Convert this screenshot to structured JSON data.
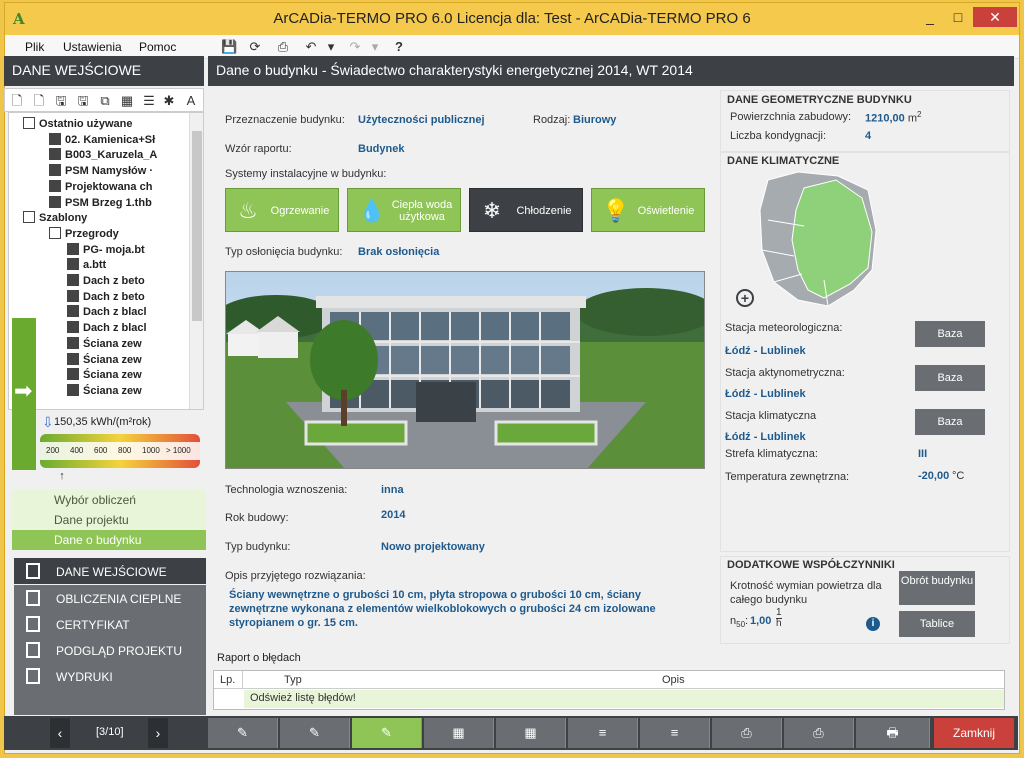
{
  "window": {
    "title": "ArCADia-TERMO PRO 6.0 Licencja dla: Test - ArCADia-TERMO PRO 6",
    "logo_glyph": "A",
    "minimize": "_",
    "maximize": "□",
    "close": "✕"
  },
  "menu": [
    "Plik",
    "Ustawienia",
    "Pomoc"
  ],
  "left": {
    "header": "DANE WEJŚCIOWE",
    "tree": [
      {
        "label": "Ostatnio używane",
        "level": 1,
        "kind": "folder"
      },
      {
        "label": "02. Kamienica+Sł",
        "level": 2,
        "kind": "doc"
      },
      {
        "label": "B003_Karuzela_A",
        "level": 2,
        "kind": "doc"
      },
      {
        "label": "PSM Namysłów ·",
        "level": 2,
        "kind": "doc"
      },
      {
        "label": "Projektowana ch",
        "level": 2,
        "kind": "doc"
      },
      {
        "label": "PSM Brzeg 1.thb",
        "level": 2,
        "kind": "doc"
      },
      {
        "label": "Szablony",
        "level": 1,
        "kind": "folder"
      },
      {
        "label": "Przegrody",
        "level": 2,
        "kind": "folder"
      },
      {
        "label": "PG- moja.bt",
        "level": 3,
        "kind": "doc"
      },
      {
        "label": "a.btt",
        "level": 3,
        "kind": "doc"
      },
      {
        "label": "Dach z beto",
        "level": 3,
        "kind": "doc"
      },
      {
        "label": "Dach z beto",
        "level": 3,
        "kind": "doc"
      },
      {
        "label": "Dach z blacl",
        "level": 3,
        "kind": "doc"
      },
      {
        "label": "Dach z blacl",
        "level": 3,
        "kind": "doc"
      },
      {
        "label": "Ściana zew",
        "level": 3,
        "kind": "doc"
      },
      {
        "label": "Ściana zew",
        "level": 3,
        "kind": "doc"
      },
      {
        "label": "Ściana zew",
        "level": 3,
        "kind": "doc"
      },
      {
        "label": "Ściana zew",
        "level": 3,
        "kind": "doc"
      }
    ],
    "energy_value": "150,35 kWh/(m²rok)",
    "energy_ticks": [
      "200",
      "400",
      "600",
      "800",
      "1000",
      "> 1000"
    ],
    "energy_indicator": 0.12,
    "sub_nav": [
      "Wybór obliczeń",
      "Dane projektu",
      "Dane o budynku"
    ],
    "main_nav": [
      "DANE WEJŚCIOWE",
      "OBLICZENIA CIEPLNE",
      "CERTYFIKAT",
      "PODGLĄD PROJEKTU",
      "WYDRUKI"
    ]
  },
  "main": {
    "header": "Dane o budynku - Świadectwo charakterystyki energetycznej 2014, WT 2014",
    "przeznaczenie_label": "Przeznaczenie budynku:",
    "przeznaczenie_value": "Użyteczności publicznej",
    "rodzaj_label": "Rodzaj:",
    "rodzaj_value": "Biurowy",
    "wzor_label": "Wzór raportu:",
    "wzor_value": "Budynek",
    "systemy_label": "Systemy instalacyjne w budynku:",
    "systems": [
      {
        "label": "Ogrzewanie",
        "icon": "flame-icon",
        "glyph": "♨",
        "active": false
      },
      {
        "label": "Ciepła woda użytkowa",
        "icon": "water-drop-icon",
        "glyph": "💧",
        "active": false
      },
      {
        "label": "Chłodzenie",
        "icon": "snowflake-icon",
        "glyph": "❄",
        "active": true
      },
      {
        "label": "Oświetlenie",
        "icon": "bulb-icon",
        "glyph": "💡",
        "active": false
      }
    ],
    "oslona_label": "Typ osłonięcia budynku:",
    "oslona_value": "Brak osłonięcia",
    "technologia_label": "Technologia wznoszenia:",
    "technologia_value": "inna",
    "rok_label": "Rok budowy:",
    "rok_value": "2014",
    "typ_label": "Typ budynku:",
    "typ_value": "Nowo projektowany",
    "opis_label": "Opis przyjętego rozwiązania:",
    "opis_value": "Ściany wewnętrzne o grubości 10 cm, płyta stropowa o grubości 10 cm, ściany zewnętrzne wykonana z elementów wielkoblokowych o grubości 24 cm izolowane styropianem o gr. 15 cm."
  },
  "right": {
    "geo_title": "DANE GEOMETRYCZNE BUDYNKU",
    "pow_label": "Powierzchnia zabudowy:",
    "pow_value": "1210,00",
    "pow_unit": "m",
    "pow_exp": "2",
    "kond_label": "Liczba kondygnacji:",
    "kond_value": "4",
    "klim_title": "DANE KLIMATYCZNE",
    "meteo_label": "Stacja meteorologiczna:",
    "meteo_value": "Łódź - Lublinek",
    "akty_label": "Stacja aktynometryczna:",
    "akty_value": "Łódź - Lublinek",
    "klim_label": "Stacja klimatyczna",
    "klim_value": "Łódź - Lublinek",
    "strefa_label": "Strefa klimatyczna:",
    "strefa_value": "III",
    "temp_label": "Temperatura zewnętrzna:",
    "temp_value": "-20,00",
    "temp_unit": "°C",
    "baza_label": "Baza",
    "add_glyph": "+",
    "dod_title": "DODATKOWE WSPÓŁCZYNNIKI",
    "krot_label": "Krotność wymian powietrza dla całego budynku",
    "n50_label": "n",
    "n50_sub": "50",
    "n50_value": "1,00",
    "n50_unit_num": "1",
    "n50_unit_den": "h",
    "obrot_label": "Obrót budynku",
    "tablice_label": "Tablice",
    "info_glyph": "i"
  },
  "errors": {
    "title": "Raport o błędach",
    "col_lp": "Lp.",
    "col_typ": "Typ",
    "col_opis": "Opis",
    "row": "Odśwież listę błędów!"
  },
  "bottom": {
    "pager": "[3/10]",
    "prev": "‹",
    "next": "›",
    "close": "Zamknij"
  }
}
